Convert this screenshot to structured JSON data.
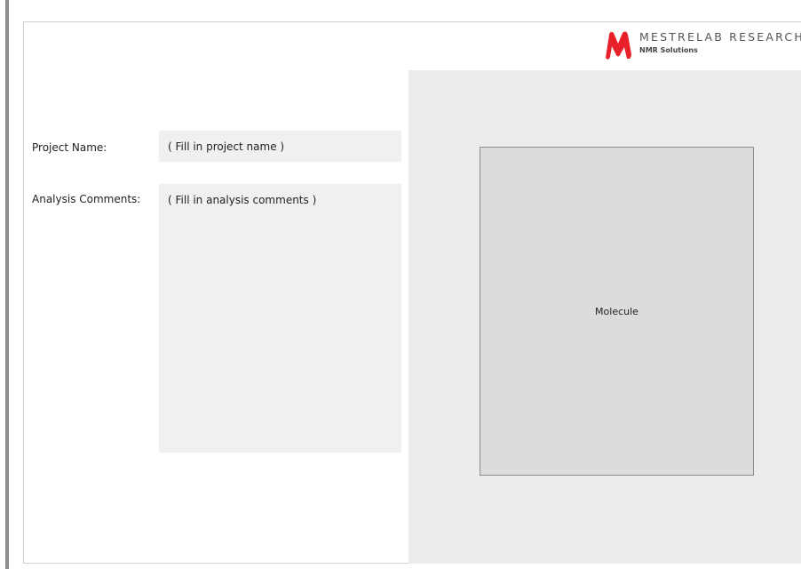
{
  "header": {
    "logo_name": "MESTRELAB RESEARCH",
    "logo_tagline": "NMR Solutions",
    "logo_icon": "mestrelab-m-logo",
    "brand_color": "#e8202a"
  },
  "form": {
    "project_label": "Project Name:",
    "project_value": "( Fill in project name )",
    "comments_label": "Analysis Comments:",
    "comments_value": "( Fill in analysis comments )"
  },
  "molecule": {
    "label": "Molecule"
  },
  "colors": {
    "panel_background": "#ececec",
    "field_background": "#f0f0f0",
    "molecule_background": "#dcdcdc"
  }
}
